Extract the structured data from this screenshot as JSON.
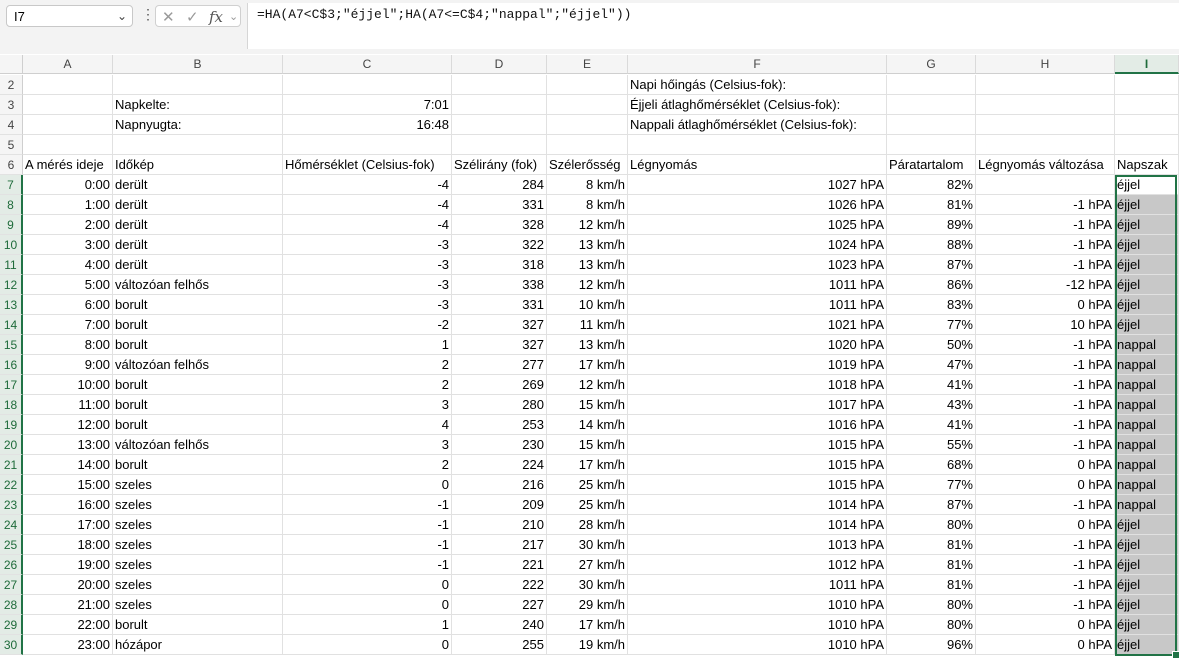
{
  "formula_bar": {
    "name_box": "I7",
    "formula": "=HA(A7<C$3;\"éjjel\";HA(A7<=C$4;\"nappal\";\"éjjel\"))",
    "cancel_icon": "x-icon",
    "enter_icon": "check-icon",
    "fx_label": "fx"
  },
  "columns": [
    "A",
    "B",
    "C",
    "D",
    "E",
    "F",
    "G",
    "H",
    "I"
  ],
  "top_rows": {
    "row2": {
      "F": "Napi hőingás (Celsius-fok):"
    },
    "row3": {
      "B": "Napkelte:",
      "C": "7:01",
      "F": "Éjjeli átlaghőmérséklet (Celsius-fok):"
    },
    "row4": {
      "B": "Napnyugta:",
      "C": "16:48",
      "F": "Nappali átlaghőmérséklet (Celsius-fok):"
    }
  },
  "table_headers": [
    "A mérés ideje",
    "Időkép",
    "Hőmérséklet (Celsius-fok)",
    "Szélirány (fok)",
    "Szélerősség",
    "Légnyomás",
    "Páratartalom",
    "Légnyomás változása",
    "Napszak"
  ],
  "rows": [
    [
      "0:00",
      "derült",
      "-4",
      "284",
      "8 km/h",
      "1027 hPA",
      "82%",
      "",
      "éjjel"
    ],
    [
      "1:00",
      "derült",
      "-4",
      "331",
      "8 km/h",
      "1026 hPA",
      "81%",
      "-1 hPA",
      "éjjel"
    ],
    [
      "2:00",
      "derült",
      "-4",
      "328",
      "12 km/h",
      "1025 hPA",
      "89%",
      "-1 hPA",
      "éjjel"
    ],
    [
      "3:00",
      "derült",
      "-3",
      "322",
      "13 km/h",
      "1024 hPA",
      "88%",
      "-1 hPA",
      "éjjel"
    ],
    [
      "4:00",
      "derült",
      "-3",
      "318",
      "13 km/h",
      "1023 hPA",
      "87%",
      "-1 hPA",
      "éjjel"
    ],
    [
      "5:00",
      "változóan felhős",
      "-3",
      "338",
      "12 km/h",
      "1011 hPA",
      "86%",
      "-12 hPA",
      "éjjel"
    ],
    [
      "6:00",
      "borult",
      "-3",
      "331",
      "10 km/h",
      "1011 hPA",
      "83%",
      "0 hPA",
      "éjjel"
    ],
    [
      "7:00",
      "borult",
      "-2",
      "327",
      "11 km/h",
      "1021 hPA",
      "77%",
      "10 hPA",
      "éjjel"
    ],
    [
      "8:00",
      "borult",
      "1",
      "327",
      "13 km/h",
      "1020 hPA",
      "50%",
      "-1 hPA",
      "nappal"
    ],
    [
      "9:00",
      "változóan felhős",
      "2",
      "277",
      "17 km/h",
      "1019 hPA",
      "47%",
      "-1 hPA",
      "nappal"
    ],
    [
      "10:00",
      "borult",
      "2",
      "269",
      "12 km/h",
      "1018 hPA",
      "41%",
      "-1 hPA",
      "nappal"
    ],
    [
      "11:00",
      "borult",
      "3",
      "280",
      "15 km/h",
      "1017 hPA",
      "43%",
      "-1 hPA",
      "nappal"
    ],
    [
      "12:00",
      "borult",
      "4",
      "253",
      "14 km/h",
      "1016 hPA",
      "41%",
      "-1 hPA",
      "nappal"
    ],
    [
      "13:00",
      "változóan felhős",
      "3",
      "230",
      "15 km/h",
      "1015 hPA",
      "55%",
      "-1 hPA",
      "nappal"
    ],
    [
      "14:00",
      "borult",
      "2",
      "224",
      "17 km/h",
      "1015 hPA",
      "68%",
      "0 hPA",
      "nappal"
    ],
    [
      "15:00",
      "szeles",
      "0",
      "216",
      "25 km/h",
      "1015 hPA",
      "77%",
      "0 hPA",
      "nappal"
    ],
    [
      "16:00",
      "szeles",
      "-1",
      "209",
      "25 km/h",
      "1014 hPA",
      "87%",
      "-1 hPA",
      "nappal"
    ],
    [
      "17:00",
      "szeles",
      "-1",
      "210",
      "28 km/h",
      "1014 hPA",
      "80%",
      "0 hPA",
      "éjjel"
    ],
    [
      "18:00",
      "szeles",
      "-1",
      "217",
      "30 km/h",
      "1013 hPA",
      "81%",
      "-1 hPA",
      "éjjel"
    ],
    [
      "19:00",
      "szeles",
      "-1",
      "221",
      "27 km/h",
      "1012 hPA",
      "81%",
      "-1 hPA",
      "éjjel"
    ],
    [
      "20:00",
      "szeles",
      "0",
      "222",
      "30 km/h",
      "1011 hPA",
      "81%",
      "-1 hPA",
      "éjjel"
    ],
    [
      "21:00",
      "szeles",
      "0",
      "227",
      "29 km/h",
      "1010 hPA",
      "80%",
      "-1 hPA",
      "éjjel"
    ],
    [
      "22:00",
      "borult",
      "1",
      "240",
      "17 km/h",
      "1010 hPA",
      "80%",
      "0 hPA",
      "éjjel"
    ],
    [
      "23:00",
      "hózápor",
      "0",
      "255",
      "19 km/h",
      "1010 hPA",
      "96%",
      "0 hPA",
      "éjjel"
    ]
  ],
  "row_numbers": [
    "2",
    "3",
    "4",
    "5",
    "6",
    "7",
    "8",
    "9",
    "10",
    "11",
    "12",
    "13",
    "14",
    "15",
    "16",
    "17",
    "18",
    "19",
    "20",
    "21",
    "22",
    "23",
    "24",
    "25",
    "26",
    "27",
    "28",
    "29",
    "30"
  ],
  "selection": {
    "active_cell": "I7",
    "range": "I7:I30",
    "accent": "#217346",
    "shade": "#c8c8c8"
  }
}
